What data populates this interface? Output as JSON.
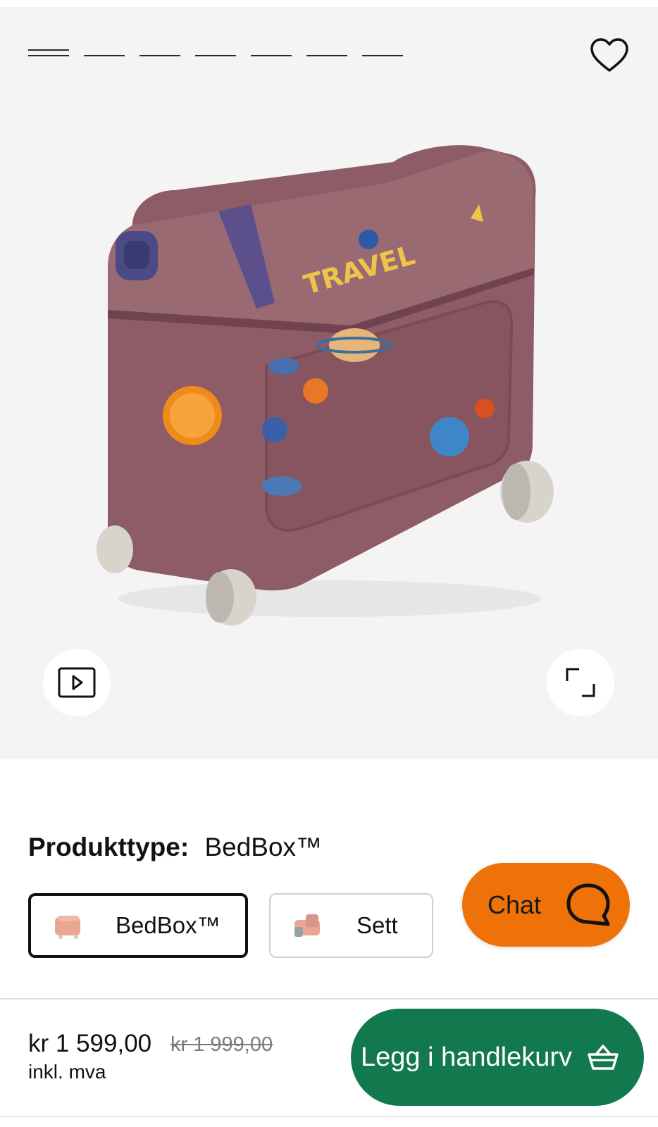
{
  "gallery": {
    "slide_count": 7,
    "active_slide": 1,
    "wishlist_icon": "heart-outline-icon",
    "video_icon": "play-icon",
    "zoom_icon": "expand-icon",
    "product_text": "TRAVEL",
    "product_color": "#8e5c66"
  },
  "product_type": {
    "label": "Produkttype:",
    "selected_value": "BedBox™",
    "options": [
      {
        "label": "BedBox™",
        "selected": true
      },
      {
        "label": "Sett",
        "selected": false
      }
    ]
  },
  "chat": {
    "label": "Chat",
    "icon": "chat-bubble-icon",
    "color": "#ee7208"
  },
  "purchase": {
    "price": "kr 1 599,00",
    "original_price": "kr 1 999,00",
    "vat_note": "inkl. mva",
    "add_to_cart_label": "Legg i handlekurv",
    "cart_icon": "basket-icon",
    "button_color": "#12784e"
  }
}
